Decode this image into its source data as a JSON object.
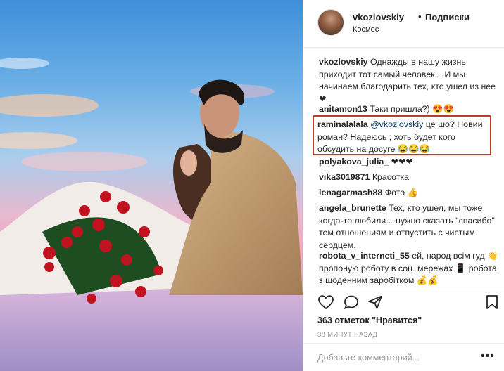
{
  "header": {
    "username": "vkozlovskiy",
    "separator": "•",
    "follow_label": "Подписки",
    "location": "Космос"
  },
  "comments": [
    {
      "user": "vkozlovskiy",
      "text": "Однажды в нашу жизнь приходит тот самый человек... И мы начинаем благодарить тех, кто ушел из нее ❤"
    },
    {
      "user": "anitamon13",
      "text": "Таки пришла?) 😍😍"
    },
    {
      "user": "raminalalala",
      "mention": "@vkozlovskiy",
      "text": "це шо? Новий роман? Надеюсь ; хоть будет кого обсудить на досуге 😂😂😂"
    },
    {
      "user": "polyakova_julia_",
      "text": "❤❤❤"
    },
    {
      "user": "vika3019871",
      "text": "Красотка"
    },
    {
      "user": "lenagarmash88",
      "text": "Фото 👍"
    },
    {
      "user": "angela_brunette",
      "text": "Тех, кто ушел, мы тоже когда-то любили... нужно сказать \"спасибо\" тем отношениям и отпустить с чистым сердцем."
    },
    {
      "user": "robota_v_interneti_55",
      "text": "ей, народ всім гуд 👋 пропоную роботу в соц. мережах 📱 робота з щоденним заробітком 💰💰"
    }
  ],
  "actions": {
    "likes": "363 отметок \"Нравится\"",
    "time": "38 МИНУТ НАЗАД"
  },
  "add_comment": {
    "placeholder": "Добавьте комментарий...",
    "more": "•••"
  },
  "colors": {
    "highlight_border": "#c0392b",
    "text": "#262626",
    "muted": "#999999"
  }
}
